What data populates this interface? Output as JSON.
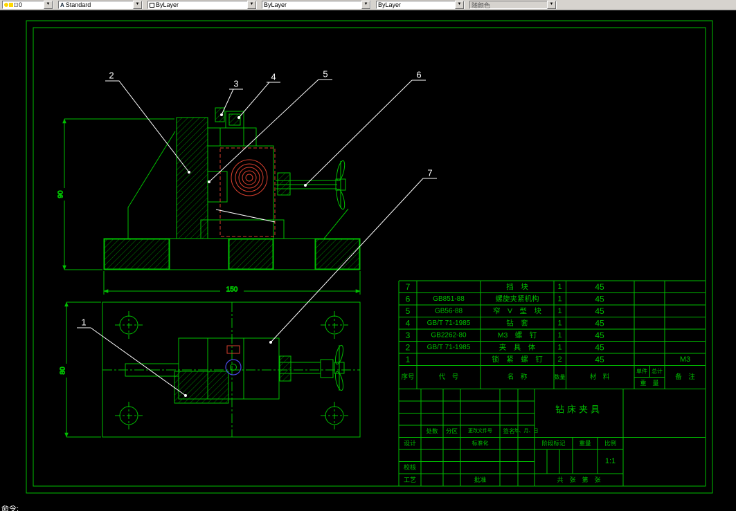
{
  "toolbar": {
    "layer": {
      "value": "0"
    },
    "style": {
      "value": "Standard"
    },
    "color": {
      "value": "ByLayer"
    },
    "linetype": {
      "value": "ByLayer"
    },
    "lineweight": {
      "value": "ByLayer"
    },
    "plotstyle": {
      "value": "随颜色"
    }
  },
  "statusbar": {
    "command": "命令:"
  },
  "drawing": {
    "balloons": {
      "b1": "1",
      "b2": "2",
      "b3": "3",
      "b4": "4",
      "b5": "5",
      "b6": "6",
      "b7": "7"
    },
    "dims": {
      "front_height": "90",
      "base_width": "150",
      "plan_height": "80"
    }
  },
  "bom": {
    "headers": {
      "no": "序号",
      "code": "代　号",
      "name": "名　称",
      "qty": "数量",
      "material": "材　料",
      "unit": "单件",
      "total": "总计",
      "weight": "重　量",
      "remark": "备　注"
    },
    "rows": [
      {
        "no": "7",
        "code": "",
        "name": "挡　块",
        "qty": "1",
        "material": "45",
        "remark": ""
      },
      {
        "no": "6",
        "code": "GB851-88",
        "name": "螺旋夹紧机构",
        "qty": "1",
        "material": "45",
        "remark": ""
      },
      {
        "no": "5",
        "code": "GB56-88",
        "name": "窄　V　型　块",
        "qty": "1",
        "material": "45",
        "remark": ""
      },
      {
        "no": "4",
        "code": "GB/T 71-1985",
        "name": "钻　套",
        "qty": "1",
        "material": "45",
        "remark": ""
      },
      {
        "no": "3",
        "code": "GB2262-80",
        "name": "M3　螺　钉",
        "qty": "1",
        "material": "45",
        "remark": ""
      },
      {
        "no": "2",
        "code": "GB/T 71-1985",
        "name": "夹　具　体",
        "qty": "1",
        "material": "45",
        "remark": ""
      },
      {
        "no": "1",
        "code": "",
        "name": "锁　紧　螺　钉",
        "qty": "2",
        "material": "45",
        "remark": "M3"
      }
    ]
  },
  "titleblock": {
    "title": "钻床夹具",
    "scale_value": "1:1",
    "labels": {
      "counts": "处数",
      "zone": "分区",
      "change_doc": "更改文件号",
      "signature": "签名",
      "date": "年、月、日",
      "design": "设计",
      "standardization": "标准化",
      "check": "校核",
      "process": "工艺",
      "approve": "批准",
      "stage_mark": "阶段标记",
      "weight": "重量",
      "scale": "比例",
      "sheets": "共　张　第　张"
    }
  }
}
